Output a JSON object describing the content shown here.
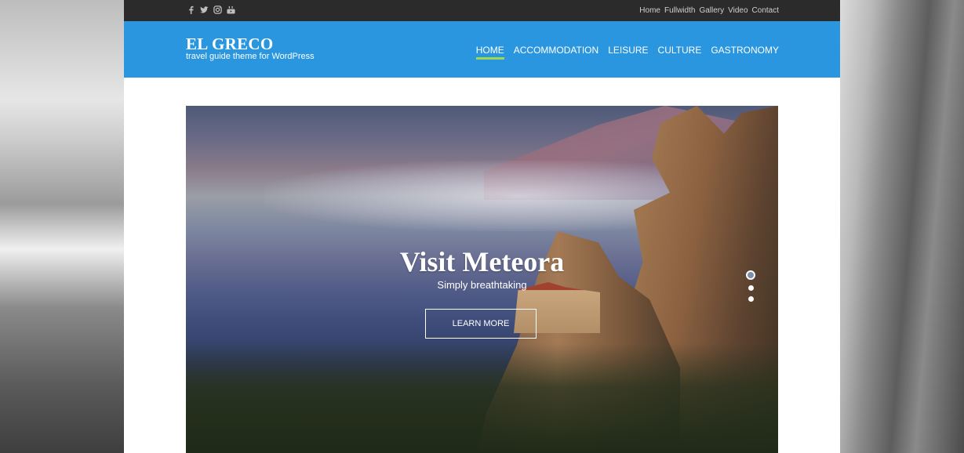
{
  "social": {
    "icons": [
      "facebook-icon",
      "twitter-icon",
      "instagram-icon",
      "youtube-icon"
    ]
  },
  "topnav": {
    "items": [
      "Home",
      "Fullwidth",
      "Gallery",
      "Video",
      "Contact"
    ]
  },
  "brand": {
    "title": "EL GRECO",
    "tagline": "travel guide theme for WordPress"
  },
  "mainnav": {
    "items": [
      "HOME",
      "ACCOMMODATION",
      "LEISURE",
      "CULTURE",
      "GASTRONOMY"
    ],
    "active": "HOME"
  },
  "slider": {
    "title": "Visit Meteora",
    "subtitle": "Simply breathtaking",
    "button": "LEARN MORE",
    "slides": 3,
    "active_slide": 1
  },
  "colors": {
    "header_bg": "#2a96e0",
    "topbar_bg": "#2b2b2b",
    "active_underline": "#9fd84a"
  }
}
